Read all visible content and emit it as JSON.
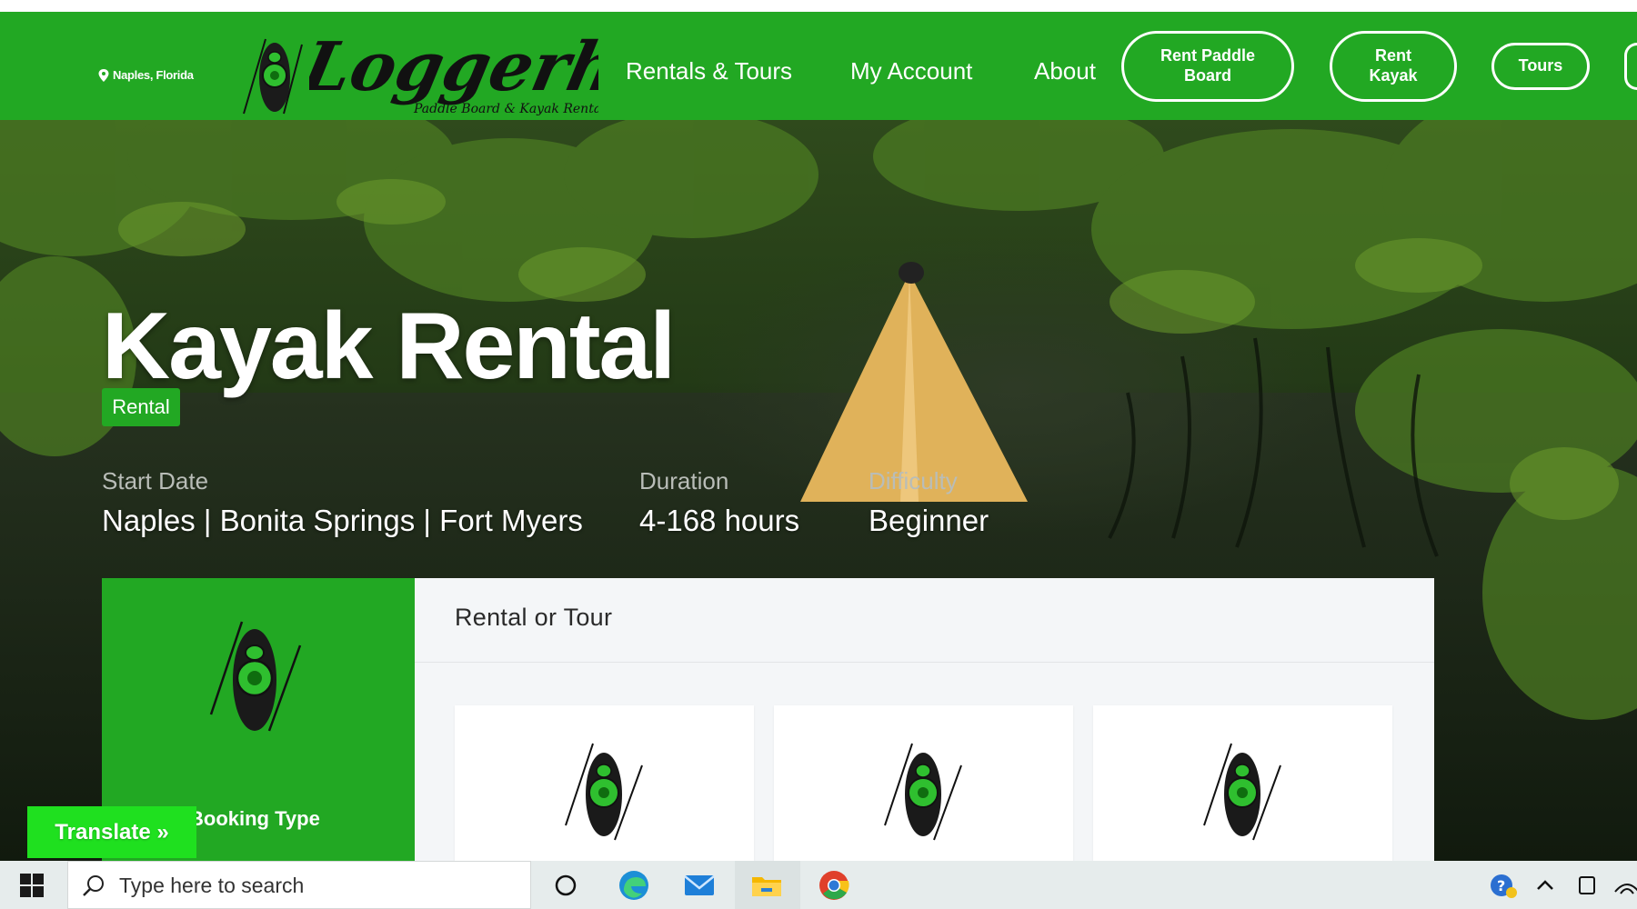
{
  "header": {
    "location": "Naples, Florida",
    "logo": {
      "name": "Loggerhead",
      "tagline": "Paddle Board & Kayak Rental"
    },
    "nav": [
      "Rentals & Tours",
      "My Account",
      "About"
    ],
    "buttons": {
      "paddle_board": [
        "Rent Paddle",
        "Board"
      ],
      "kayak": [
        "Rent",
        "Kayak"
      ],
      "tours": "Tours"
    }
  },
  "hero": {
    "badge": "Rental",
    "title": "Kayak Rental",
    "meta": [
      {
        "label": "Start Date",
        "value": "Naples | Bonita Springs | Fort Myers"
      },
      {
        "label": "Duration",
        "value": "4-168 hours"
      },
      {
        "label": "Difficulty",
        "value": "Beginner"
      }
    ]
  },
  "booking": {
    "side_label": "Booking Type",
    "panel_title": "Rental or Tour"
  },
  "translate": {
    "label": "Translate »"
  },
  "taskbar": {
    "search_placeholder": "Type here to search",
    "apps": [
      "cortana-icon",
      "edge-icon",
      "mail-icon",
      "file-explorer-icon",
      "chrome-icon"
    ],
    "tray": [
      "help-icon",
      "chevron-up-icon",
      "device-icon",
      "wifi-icon"
    ]
  },
  "colors": {
    "brand_green": "#22a823",
    "translate_green": "#1fe01f"
  }
}
